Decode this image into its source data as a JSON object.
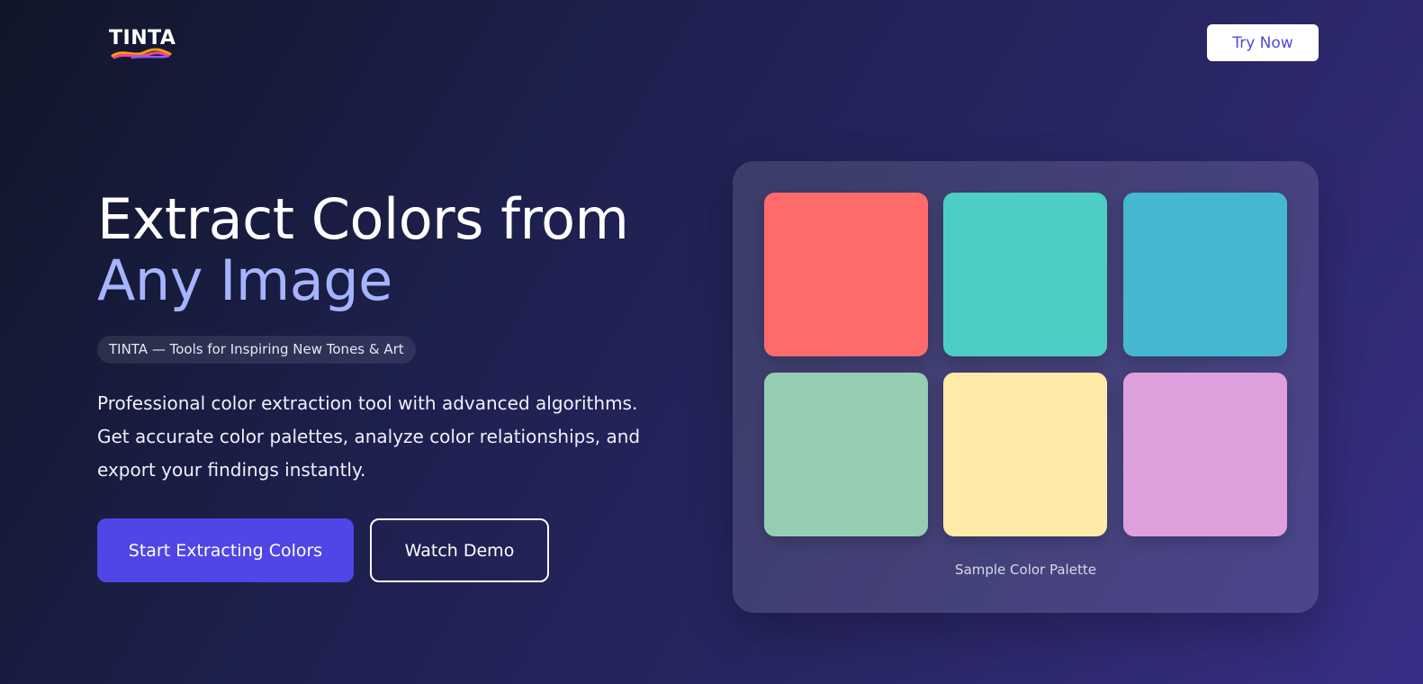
{
  "header": {
    "logo_text": "TINTA",
    "try_now_label": "Try Now"
  },
  "hero": {
    "title_line1": "Extract Colors from",
    "title_line2": "Any Image",
    "tagline": "TINTA — Tools for Inspiring New Tones & Art",
    "description": "Professional color extraction tool with advanced algorithms. Get accurate color palettes, analyze color relationships, and export your findings instantly.",
    "primary_button_label": "Start Extracting Colors",
    "secondary_button_label": "Watch Demo"
  },
  "palette": {
    "caption": "Sample Color Palette",
    "swatches": [
      {
        "color": "#ff6b6b"
      },
      {
        "color": "#4ecdc4"
      },
      {
        "color": "#45b7d1"
      },
      {
        "color": "#96ceb4"
      },
      {
        "color": "#ffeaa7"
      },
      {
        "color": "#dda0dd"
      }
    ]
  },
  "colors": {
    "accent": "#4f46e5",
    "title_highlight": "#a5b4fc",
    "logo_swoosh": [
      "#f59e0b",
      "#ec4899",
      "#8b5cf6"
    ]
  }
}
